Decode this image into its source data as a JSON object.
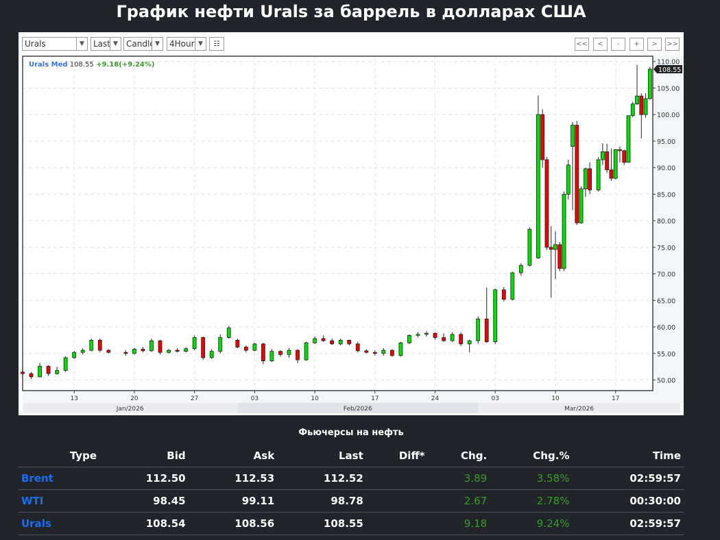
{
  "page_title": "График нефти Urals за баррель в долларах США",
  "toolbar": {
    "symbol": "Urals",
    "price_type": "Last",
    "chart_type": "Candle",
    "interval": "4Hour",
    "nav_buttons": [
      "<<",
      "<",
      "-",
      "+",
      ">",
      ">>"
    ]
  },
  "colors": {
    "up": "#00dd00",
    "down": "#ee0000",
    "legend_name": "#3a6fe8",
    "legend_change": "#3a9a2a",
    "link": "#1a6cf0",
    "positive": "#3a9a2a"
  },
  "chart_data": {
    "type": "candlestick",
    "title": "",
    "legend": {
      "name": "Urals Med",
      "last": "108.55",
      "change": "+9.18(+9.24%)"
    },
    "last_price_label": "108.55",
    "ylim": [
      48,
      111
    ],
    "yticks": [
      "50.00",
      "55.00",
      "60.00",
      "65.00",
      "70.00",
      "75.00",
      "80.00",
      "85.00",
      "90.00",
      "95.00",
      "100.00",
      "105.00",
      "110.00"
    ],
    "xlim": [
      "2026-01-07",
      "2026-03-21T08:00"
    ],
    "xticks": [
      {
        "date": "2026-01-13",
        "label": "13"
      },
      {
        "date": "2026-01-20",
        "label": "20"
      },
      {
        "date": "2026-01-27",
        "label": "27"
      },
      {
        "date": "2026-02-03",
        "label": "03"
      },
      {
        "date": "2026-02-10",
        "label": "10"
      },
      {
        "date": "2026-02-17",
        "label": "17"
      },
      {
        "date": "2026-02-24",
        "label": "24"
      },
      {
        "date": "2026-03-03",
        "label": "03"
      },
      {
        "date": "2026-03-10",
        "label": "10"
      },
      {
        "date": "2026-03-17",
        "label": "17"
      }
    ],
    "months": [
      {
        "label": "Jan/2026",
        "start": "2026-01-07",
        "end": "2026-02-01"
      },
      {
        "label": "Feb/2026",
        "start": "2026-02-01",
        "end": "2026-03-01"
      },
      {
        "label": "Mar/2026",
        "start": "2026-03-01",
        "end": "2026-03-21T08:00"
      }
    ],
    "grid": true,
    "candles": [
      [
        "2026-01-07",
        51.5,
        52,
        51,
        51.2
      ],
      [
        "2026-01-08",
        51.2,
        51.5,
        50.2,
        50.6
      ],
      [
        "2026-01-09",
        50.6,
        53.2,
        50.5,
        52.6
      ],
      [
        "2026-01-10",
        52.6,
        52.8,
        50.8,
        51.2
      ],
      [
        "2026-01-11",
        51.2,
        52.5,
        51,
        51.8
      ],
      [
        "2026-01-12",
        51.8,
        54.5,
        51.5,
        54.2
      ],
      [
        "2026-01-13",
        54.2,
        55.5,
        54,
        55.2
      ],
      [
        "2026-01-14",
        55.2,
        56,
        54.8,
        55.6
      ],
      [
        "2026-01-15",
        55.6,
        57.8,
        55.4,
        57.5
      ],
      [
        "2026-01-16",
        57.5,
        57.8,
        55.2,
        55.6
      ],
      [
        "2026-01-17",
        55.6,
        55.8,
        55,
        55.2
      ],
      [
        "2026-01-19",
        55.2,
        55.6,
        54.6,
        55
      ],
      [
        "2026-01-20",
        55,
        56,
        54.8,
        55.8
      ],
      [
        "2026-01-21",
        55.8,
        56.2,
        55.2,
        55.5
      ],
      [
        "2026-01-22",
        55.5,
        57.8,
        55.3,
        57.4
      ],
      [
        "2026-01-23",
        57.4,
        57.6,
        54.8,
        55.2
      ],
      [
        "2026-01-24",
        55.2,
        55.8,
        55,
        55.6
      ],
      [
        "2026-01-25",
        55.6,
        56,
        55.2,
        55.4
      ],
      [
        "2026-01-26",
        55.4,
        56.2,
        55.2,
        55.9
      ],
      [
        "2026-01-27",
        55.9,
        58.4,
        55.6,
        58
      ],
      [
        "2026-01-28",
        58,
        58.2,
        53.8,
        54.2
      ],
      [
        "2026-01-29",
        54.2,
        55.8,
        54,
        55.4
      ],
      [
        "2026-01-30",
        55.4,
        58.6,
        55,
        58
      ],
      [
        "2026-01-31",
        58,
        60.2,
        57.8,
        59.8
      ],
      [
        "2026-02-01",
        57.5,
        57.8,
        56,
        56.2
      ],
      [
        "2026-02-02",
        56.2,
        56.5,
        55.2,
        55.6
      ],
      [
        "2026-02-03",
        55.6,
        57,
        55.4,
        56.8
      ],
      [
        "2026-02-04",
        56.8,
        57,
        53,
        53.6
      ],
      [
        "2026-02-05",
        53.6,
        55.8,
        53.4,
        55.4
      ],
      [
        "2026-02-06",
        55.4,
        55.6,
        54.4,
        54.8
      ],
      [
        "2026-02-07",
        54.8,
        56,
        54.2,
        55.6
      ],
      [
        "2026-02-08",
        55.6,
        55.8,
        53.2,
        53.8
      ],
      [
        "2026-02-09",
        53.8,
        57.2,
        53.6,
        57
      ],
      [
        "2026-02-10",
        57,
        58.2,
        56.8,
        57.8
      ],
      [
        "2026-02-11",
        57.8,
        58.4,
        57.2,
        57.4
      ],
      [
        "2026-02-12",
        57.4,
        57.8,
        56.6,
        56.8
      ],
      [
        "2026-02-13",
        56.8,
        57.8,
        56.5,
        57.5
      ],
      [
        "2026-02-14",
        57.5,
        57.6,
        56.5,
        56.8
      ],
      [
        "2026-02-15",
        56.8,
        57.2,
        55.2,
        55.5
      ],
      [
        "2026-02-16",
        55.5,
        55.8,
        55,
        55.2
      ],
      [
        "2026-02-17",
        55.2,
        55.6,
        54.6,
        55
      ],
      [
        "2026-02-18",
        55,
        56,
        54.6,
        55.6
      ],
      [
        "2026-02-19",
        55.6,
        55.8,
        54.4,
        54.6
      ],
      [
        "2026-02-20",
        54.6,
        57.2,
        54.4,
        57
      ],
      [
        "2026-02-21",
        57,
        58.6,
        56.8,
        58.4
      ],
      [
        "2026-02-22",
        58.4,
        59,
        58,
        58.6
      ],
      [
        "2026-02-23",
        58.6,
        59.2,
        58.2,
        58.8
      ],
      [
        "2026-02-24",
        58.8,
        59,
        57.6,
        58
      ],
      [
        "2026-02-25",
        58,
        58.8,
        57.2,
        57.4
      ],
      [
        "2026-02-26",
        57.4,
        59,
        57.2,
        58.6
      ],
      [
        "2026-02-27",
        58.6,
        59,
        56.4,
        56.8
      ],
      [
        "2026-02-28",
        56.8,
        57.6,
        55.2,
        57.4
      ],
      [
        "2026-03-01",
        57.4,
        62,
        56.8,
        61.5
      ],
      [
        "2026-03-02",
        61.5,
        67.4,
        57,
        57.2
      ],
      [
        "2026-03-03",
        57.2,
        67.2,
        56.8,
        67
      ],
      [
        "2026-03-04",
        67,
        67.5,
        64.8,
        65.2
      ],
      [
        "2026-03-05",
        65.2,
        70.4,
        65,
        70.2
      ],
      [
        "2026-03-06",
        70.2,
        72,
        69.6,
        71.6
      ],
      [
        "2026-03-07",
        71.6,
        78.8,
        71.4,
        78.4
      ],
      [
        "2026-03-08",
        73,
        103.6,
        72.8,
        100
      ],
      [
        "2026-03-08T12:00",
        100,
        101,
        90,
        91.5
      ],
      [
        "2026-03-09",
        91.5,
        92,
        74.5,
        75
      ],
      [
        "2026-03-09T12:00",
        75,
        79,
        65.5,
        74.6
      ],
      [
        "2026-03-10",
        74.6,
        78,
        69,
        75.5
      ],
      [
        "2026-03-10T12:00",
        75.5,
        76,
        70.5,
        71
      ],
      [
        "2026-03-11",
        71,
        85.5,
        70.5,
        85
      ],
      [
        "2026-03-11T12:00",
        85,
        91.5,
        84,
        90.5
      ],
      [
        "2026-03-12",
        94,
        98.6,
        82,
        98
      ],
      [
        "2026-03-12T12:00",
        98,
        98.8,
        79.2,
        79.6
      ],
      [
        "2026-03-13",
        79.6,
        86.5,
        79.4,
        86
      ],
      [
        "2026-03-13T12:00",
        86,
        90,
        84.5,
        89.8
      ],
      [
        "2026-03-14",
        89.8,
        91,
        85,
        85.8
      ],
      [
        "2026-03-15",
        85.8,
        92,
        85.5,
        91.5
      ],
      [
        "2026-03-15T12:00",
        91.5,
        94.6,
        90.5,
        93
      ],
      [
        "2026-03-16",
        93,
        94.5,
        89,
        89.6
      ],
      [
        "2026-03-16T12:00",
        89.6,
        93.6,
        87.5,
        88
      ],
      [
        "2026-03-17",
        88,
        93.5,
        87.8,
        93.4
      ],
      [
        "2026-03-17T12:00",
        93.4,
        94,
        91,
        93.2
      ],
      [
        "2026-03-18",
        93.2,
        93.4,
        90.5,
        91
      ],
      [
        "2026-03-18T12:00",
        91,
        99.8,
        91,
        99.8
      ],
      [
        "2026-03-19",
        99.8,
        102.4,
        99.5,
        102
      ],
      [
        "2026-03-19T12:00",
        102,
        109.4,
        101.8,
        103.5
      ],
      [
        "2026-03-20",
        103.5,
        104,
        95.5,
        100
      ],
      [
        "2026-03-20T12:00",
        100,
        104,
        99.4,
        103
      ],
      [
        "2026-03-21",
        103,
        109,
        102.8,
        108.55
      ]
    ]
  },
  "futures": {
    "heading": "Фьючерсы на нефть",
    "columns": [
      "Type",
      "Bid",
      "Ask",
      "Last",
      "Diff*",
      "Chg.",
      "Chg.%",
      "Time"
    ],
    "rows": [
      {
        "type": "Brent",
        "bid": "112.50",
        "ask": "112.53",
        "last": "112.52",
        "diff": "",
        "chg": "3.89",
        "chg_pct": "3.58%",
        "time": "02:59:57"
      },
      {
        "type": "WTI",
        "bid": "98.45",
        "ask": "99.11",
        "last": "98.78",
        "diff": "",
        "chg": "2.67",
        "chg_pct": "2.78%",
        "time": "00:30:00"
      },
      {
        "type": "Urals",
        "bid": "108.54",
        "ask": "108.56",
        "last": "108.55",
        "diff": "",
        "chg": "9.18",
        "chg_pct": "9.24%",
        "time": "02:59:57"
      }
    ]
  }
}
